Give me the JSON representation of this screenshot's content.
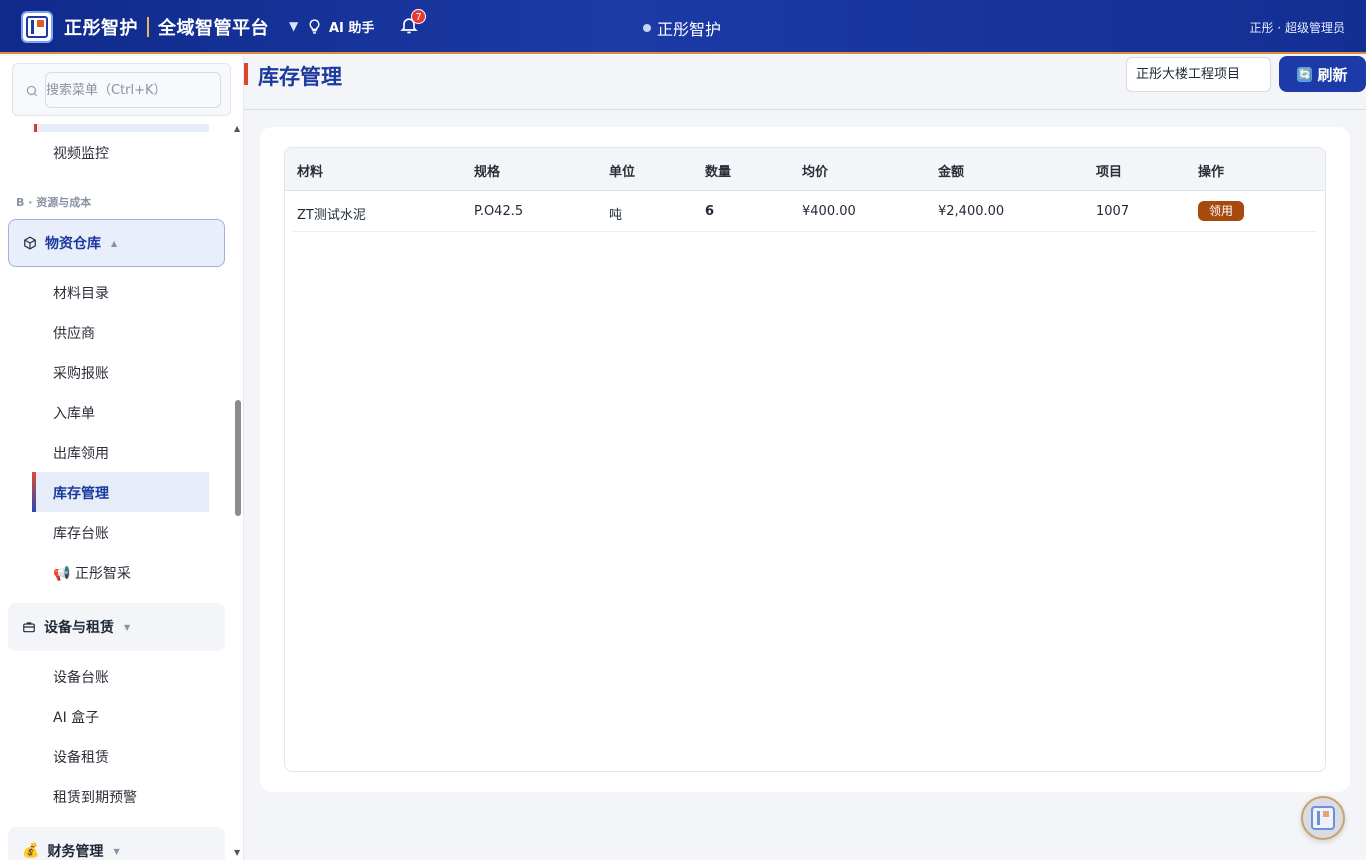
{
  "header": {
    "brand_name": "正彤智护",
    "platform_name": "全域智管平台",
    "brand_caret": "▼",
    "ai_label": "AI 助手",
    "notification_count": "7",
    "center_title": "正彤智护",
    "user_label": "正彤 · 超级管理员"
  },
  "sidebar": {
    "search_placeholder": "搜索菜单（Ctrl+K）",
    "item_video": "视频监控",
    "section_b": "B · 资源与成本",
    "group_warehouse": "物资仓库",
    "group_warehouse_caret": "▲",
    "warehouse_items": [
      "材料目录",
      "供应商",
      "采购报账",
      "入库单",
      "出库领用",
      "库存管理",
      "库存台账",
      "📢 正彤智采"
    ],
    "active_item": "库存管理",
    "group_equipment": "设备与租赁",
    "group_equipment_caret": "▼",
    "equipment_items": [
      "设备台账",
      "AI 盒子",
      "设备租赁",
      "租赁到期预警"
    ],
    "group_finance": "财务管理",
    "group_finance_icon": "💰",
    "group_finance_caret": "▼",
    "scroll_up": "▲",
    "scroll_down": "▼"
  },
  "main": {
    "page_title": "库存管理",
    "project_select": "正彤大楼工程项目",
    "refresh_label": "刷新",
    "refresh_icon": "🔄",
    "table": {
      "columns": [
        "材料",
        "规格",
        "单位",
        "数量",
        "均价",
        "金额",
        "项目",
        "操作"
      ],
      "rows": [
        {
          "material": "ZT测试水泥",
          "spec": "P.O42.5",
          "unit": "吨",
          "qty": "6",
          "avg_price": "¥400.00",
          "amount": "¥2,400.00",
          "project": "1007",
          "action": "领用"
        }
      ]
    }
  },
  "colors": {
    "header_bg": "#1b3aa6",
    "accent_orange": "#e58a3b",
    "active_blue": "#1c3a9e",
    "action_btn": "#a84a0e"
  }
}
